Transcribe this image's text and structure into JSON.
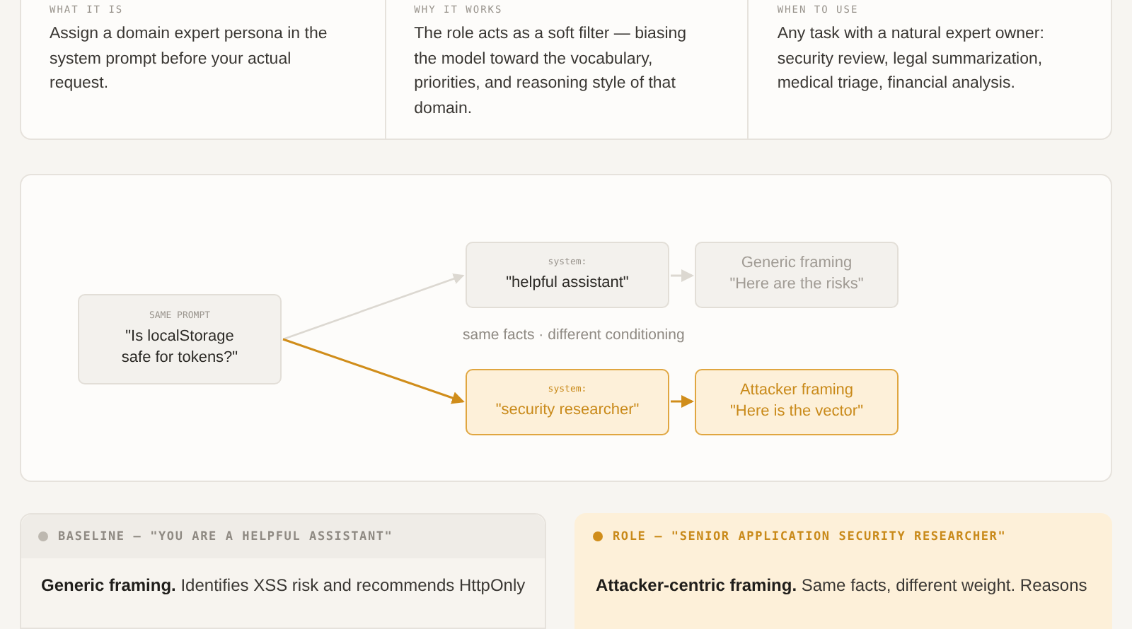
{
  "overview": [
    {
      "label": "WHAT IT IS",
      "text": "Assign a domain expert persona in the system prompt before your actual request."
    },
    {
      "label": "WHY IT WORKS",
      "text": "The role acts as a soft filter — biasing the model toward the vocabulary, priorities, and reasoning style of that domain."
    },
    {
      "label": "WHEN TO USE",
      "text": "Any task with a natural expert owner: security review, legal summarization, medical triage, financial analysis."
    }
  ],
  "diagram": {
    "source": {
      "label": "SAME PROMPT",
      "text": "\"Is localStorage safe for tokens?\""
    },
    "caption": "same facts · different conditioning",
    "branches": [
      {
        "kind": "neutral",
        "system_label": "system:",
        "system_text": "\"helpful assistant\"",
        "result_title": "Generic framing",
        "result_text": "\"Here are the risks\""
      },
      {
        "kind": "accent",
        "system_label": "system:",
        "system_text": "\"security researcher\"",
        "result_title": "Attacker framing",
        "result_text": "\"Here is the vector\""
      }
    ]
  },
  "panels": [
    {
      "kind": "neutral",
      "title": "BASELINE — \"YOU ARE A HELPFUL ASSISTANT\"",
      "body": "**Generic framing.** Identifies XSS risk and recommends HttpOnly"
    },
    {
      "kind": "accent",
      "title": "ROLE — \"SENIOR APPLICATION SECURITY RESEARCHER\"",
      "body": "**Attacker-centric framing.** Same facts, different weight. Reasons"
    }
  ]
}
